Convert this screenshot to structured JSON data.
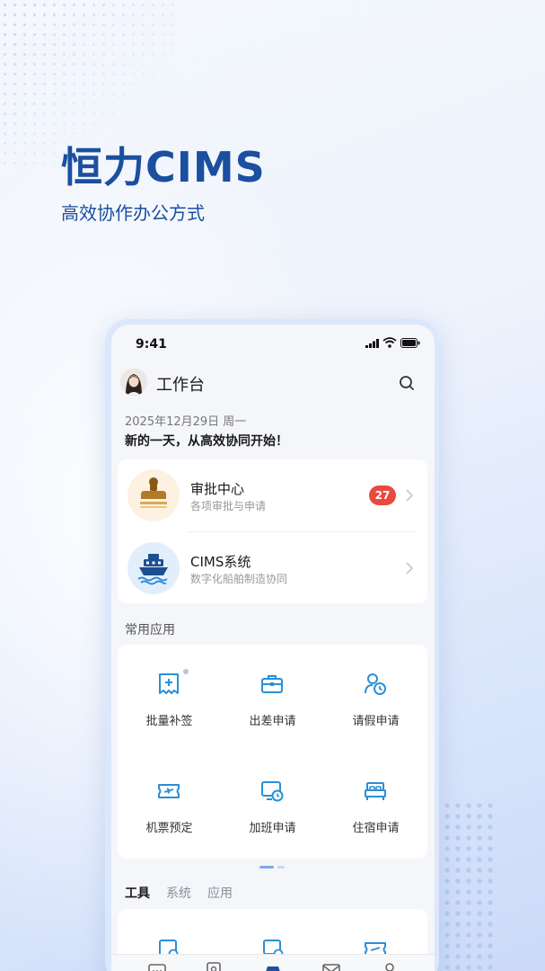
{
  "hero": {
    "title": "恒力CIMS",
    "subtitle": "高效协作办公方式"
  },
  "status_bar": {
    "time": "9:41"
  },
  "header": {
    "title": "工作台"
  },
  "greeting": {
    "date": "2025年12月29日  周一",
    "slogan": "新的一天，从高效协同开始！"
  },
  "entries": [
    {
      "title": "审批中心",
      "subtitle": "各项审批与申请",
      "badge": "27",
      "icon": "stamp-icon"
    },
    {
      "title": "CIMS系统",
      "subtitle": "数字化船舶制造协同",
      "icon": "ship-icon"
    }
  ],
  "common_apps": {
    "label": "常用应用",
    "items": [
      {
        "label": "批量补签",
        "icon": "batch-sign-icon"
      },
      {
        "label": "出差申请",
        "icon": "briefcase-icon"
      },
      {
        "label": "请假申请",
        "icon": "leave-clock-icon"
      },
      {
        "label": "机票预定",
        "icon": "plane-ticket-icon"
      },
      {
        "label": "加班申请",
        "icon": "overtime-icon"
      },
      {
        "label": "住宿申请",
        "icon": "bed-icon"
      }
    ]
  },
  "tool_tabs": [
    "工具",
    "系统",
    "应用"
  ],
  "bottom_nav": [
    "message-icon",
    "contacts-icon",
    "workbench-icon",
    "mail-icon",
    "profile-icon"
  ],
  "colors": {
    "brand": "#1b4fa0",
    "icon_blue": "#2a8fd8",
    "badge_red": "#e84a3f"
  }
}
